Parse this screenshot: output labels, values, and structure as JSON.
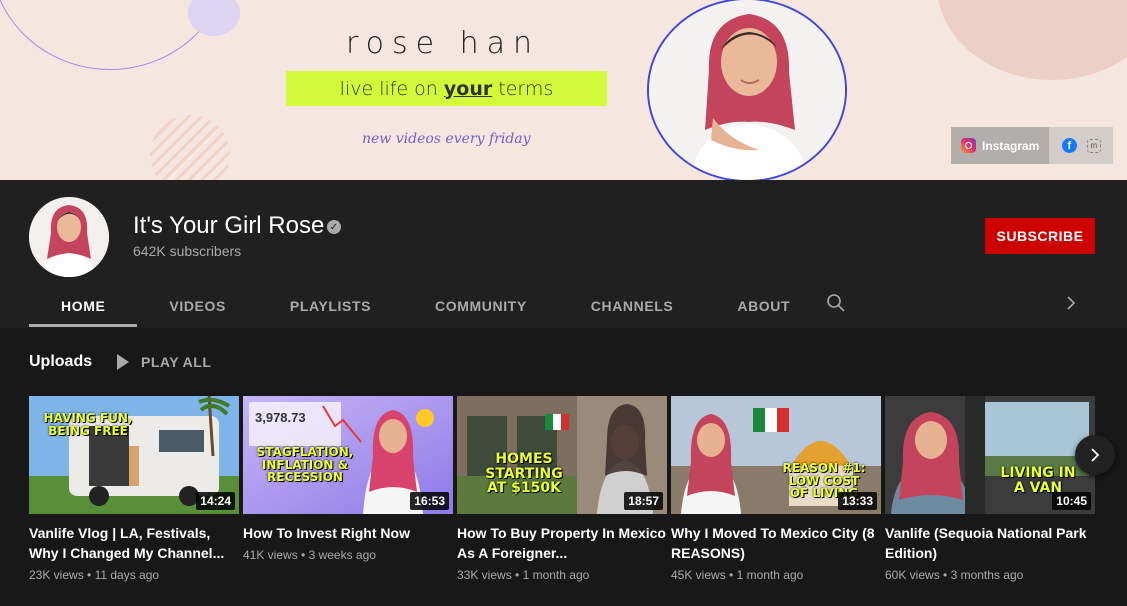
{
  "banner": {
    "brand": "rose han",
    "tagline_pre": "live life on ",
    "tagline_bold": "your",
    "tagline_post": " terms",
    "schedule": "new videos every friday",
    "links": {
      "instagram": "Instagram"
    }
  },
  "channel": {
    "name": "It's Your Girl Rose",
    "subscribers": "642K subscribers",
    "subscribe_label": "SUBSCRIBE"
  },
  "tabs": [
    "HOME",
    "VIDEOS",
    "PLAYLISTS",
    "COMMUNITY",
    "CHANNELS",
    "ABOUT"
  ],
  "uploads": {
    "title": "Uploads",
    "play_all": "PLAY ALL"
  },
  "videos": [
    {
      "title": "Vanlife Vlog | LA, Festivals, Why I Changed My Channel...",
      "views": "23K views",
      "age": "11 days ago",
      "duration": "14:24",
      "overlay": "HAVING FUN, BEING FREE"
    },
    {
      "title": "How To Invest Right Now",
      "views": "41K views",
      "age": "3 weeks ago",
      "duration": "16:53",
      "overlay": "STAGFLATION, INFLATION & RECESSION",
      "chart_number": "3,978.73"
    },
    {
      "title": "How To Buy Property In Mexico As A Foreigner...",
      "views": "33K views",
      "age": "1 month ago",
      "duration": "18:57",
      "overlay": "HOMES STARTING AT $150K"
    },
    {
      "title": "Why I Moved To Mexico City (8 REASONS)",
      "views": "45K views",
      "age": "1 month ago",
      "duration": "13:33",
      "overlay": "REASON #1: LOW COST OF LIVING"
    },
    {
      "title": "Vanlife (Sequoia National Park Edition)",
      "views": "60K views",
      "age": "3 months ago",
      "duration": "10:45",
      "overlay": "LIVING IN A VAN"
    }
  ],
  "colors": {
    "subscribe": "#cc0000",
    "accent_lime": "#d4f93a",
    "header_bg": "#202020",
    "page_bg": "#181818"
  }
}
